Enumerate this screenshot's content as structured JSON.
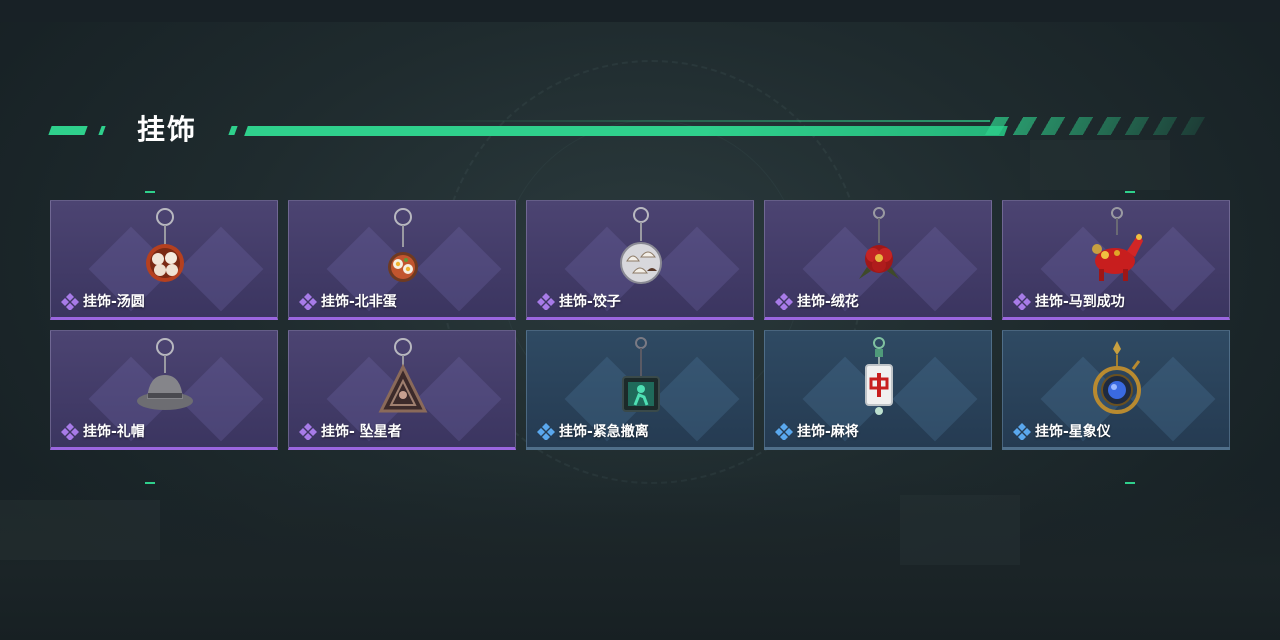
{
  "section": {
    "title": "挂饰"
  },
  "colors": {
    "accent": "#2fd08c",
    "purple_rarity": "#9b66e0",
    "blue_rarity": "#4a9be0"
  },
  "items": [
    {
      "label": "挂饰-汤圆",
      "rarity": "purple",
      "icon": "tangyuan-charm-icon"
    },
    {
      "label": "挂饰-北非蛋",
      "rarity": "purple",
      "icon": "shakshuka-charm-icon"
    },
    {
      "label": "挂饰-饺子",
      "rarity": "purple",
      "icon": "dumplings-charm-icon"
    },
    {
      "label": "挂饰-绒花",
      "rarity": "purple",
      "icon": "velvet-flower-charm-icon"
    },
    {
      "label": "挂饰-马到成功",
      "rarity": "purple",
      "icon": "horse-success-charm-icon"
    },
    {
      "label": "挂饰-礼帽",
      "rarity": "purple",
      "icon": "top-hat-charm-icon"
    },
    {
      "label": "挂饰- 坠星者",
      "rarity": "purple",
      "icon": "star-faller-charm-icon"
    },
    {
      "label": "挂饰-紧急撤离",
      "rarity": "blue",
      "icon": "emergency-evac-charm-icon"
    },
    {
      "label": "挂饰-麻将",
      "rarity": "blue",
      "icon": "mahjong-charm-icon"
    },
    {
      "label": "挂饰-星象仪",
      "rarity": "blue",
      "icon": "astrolabe-charm-icon"
    }
  ]
}
